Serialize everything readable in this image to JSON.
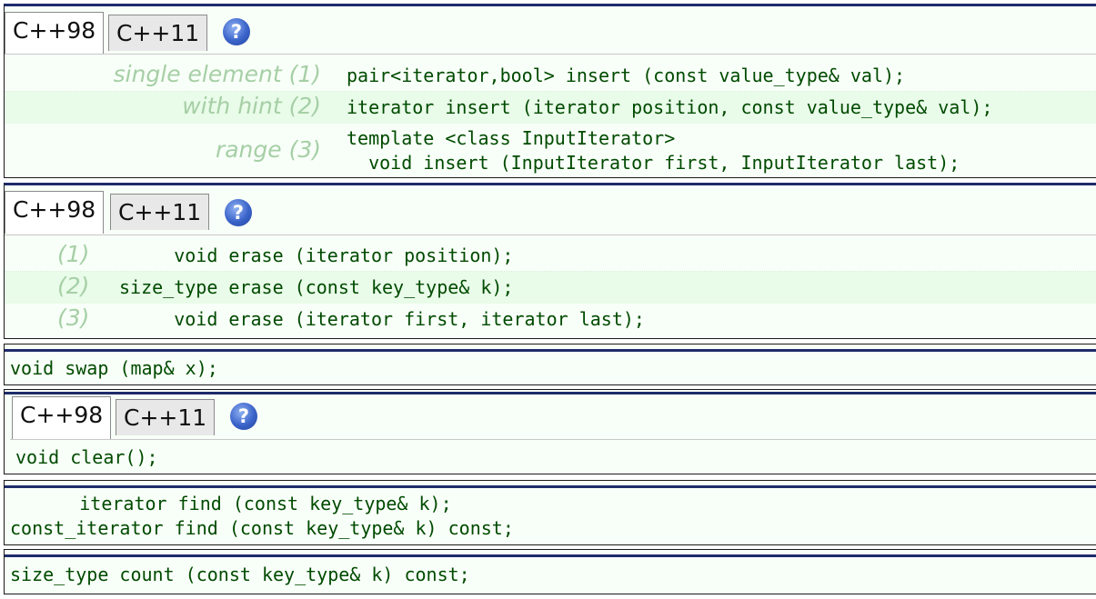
{
  "tab_labels": [
    "C++98",
    "C++11"
  ],
  "help_icon": {
    "glyph": "?",
    "icon": "help-icon"
  },
  "insert": {
    "rows": [
      {
        "label": "single element (1)",
        "code": "pair<iterator,bool> insert (const value_type& val);"
      },
      {
        "label": "with hint (2)",
        "code": "iterator insert (iterator position, const value_type& val);"
      },
      {
        "label": "range (3)",
        "code_line1": "template <class InputIterator>",
        "code_line2": "  void insert (InputIterator first, InputIterator last);"
      }
    ]
  },
  "erase": {
    "rows": [
      {
        "label": "(1)",
        "code": "     void erase (iterator position);"
      },
      {
        "label": "(2)",
        "code": "size_type erase (const key_type& k);"
      },
      {
        "label": "(3)",
        "code": "     void erase (iterator first, iterator last);"
      }
    ]
  },
  "swap": {
    "code": "void swap (map& x);"
  },
  "clear": {
    "code": "void clear();"
  },
  "find": {
    "line1": "      iterator find (const key_type& k);",
    "line2": "const_iterator find (const key_type& k) const;"
  },
  "count": {
    "code": "size_type count (const key_type& k) const;"
  },
  "colors": {
    "code": "#004a00",
    "label": "#a6cfa6",
    "panel_bg": "#f8fff8",
    "row_alt": "#e9fbe9",
    "border_top": "#1e2b6b"
  }
}
